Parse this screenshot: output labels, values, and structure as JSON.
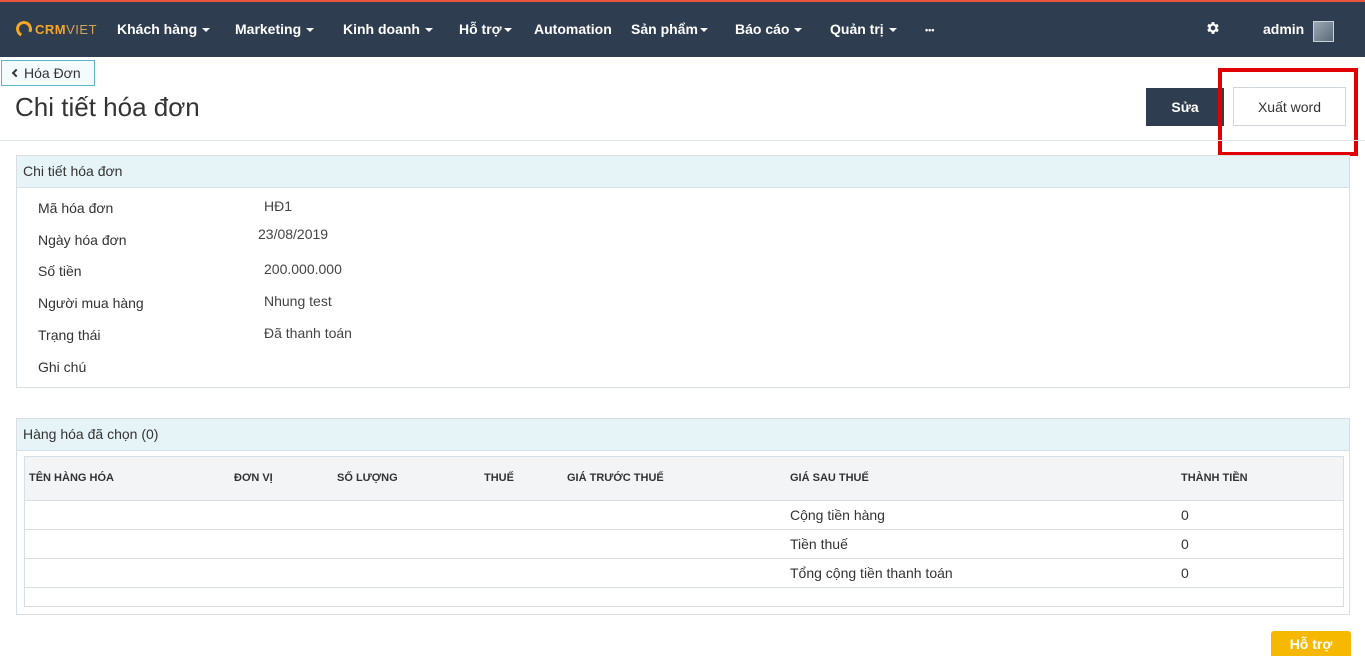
{
  "nav": {
    "logo_main": "CRM",
    "logo_sub": "VIET",
    "items": [
      {
        "label": "Khách hàng"
      },
      {
        "label": "Marketing"
      },
      {
        "label": "Kinh doanh"
      },
      {
        "label": "Hỗ trợ"
      },
      {
        "label": "Automation"
      },
      {
        "label": "Sản phẩm"
      },
      {
        "label": "Báo cáo"
      },
      {
        "label": "Quản trị"
      },
      {
        "label": "•••"
      }
    ],
    "user": "admin",
    "settings_icon": "gear-icon"
  },
  "breadcrumb": {
    "back_label": "Hóa Đơn"
  },
  "page": {
    "title": "Chi tiết hóa đơn",
    "edit_label": "Sửa",
    "export_label": "Xuất word"
  },
  "detail_panel": {
    "heading": "Chi tiết hóa đơn",
    "fields": [
      {
        "label": "Mã hóa đơn",
        "value": "HĐ1"
      },
      {
        "label": "Ngày hóa đơn",
        "value": "23/08/2019"
      },
      {
        "label": "Số tiền",
        "value": "200.000.000"
      },
      {
        "label": "Người mua hàng",
        "value": "Nhung test"
      },
      {
        "label": "Trạng thái",
        "value": "Đã thanh toán"
      },
      {
        "label": "Ghi chú",
        "value": ""
      }
    ]
  },
  "goods_panel": {
    "heading": "Hàng hóa đã chọn (0)",
    "columns": [
      "TÊN HÀNG HÓA",
      "ĐƠN VỊ",
      "SỐ LƯỢNG",
      "THUẾ",
      "GIÁ TRƯỚC THUẾ",
      "GIÁ SAU THUẾ",
      "THÀNH TIỀN"
    ],
    "summary_rows": [
      {
        "label": "Cộng tiền hàng",
        "value": "0"
      },
      {
        "label": "Tiền thuế",
        "value": "0"
      },
      {
        "label": "Tổng cộng tiền thanh toán",
        "value": "0"
      }
    ]
  },
  "support": {
    "label": "Hỗ trợ"
  },
  "colors": {
    "nav_bg": "#2e3d4f",
    "accent_orange": "#f5a623",
    "panel_head_bg": "#e6f4f8",
    "highlight_red": "#e00000",
    "support_yellow": "#f7b800"
  }
}
